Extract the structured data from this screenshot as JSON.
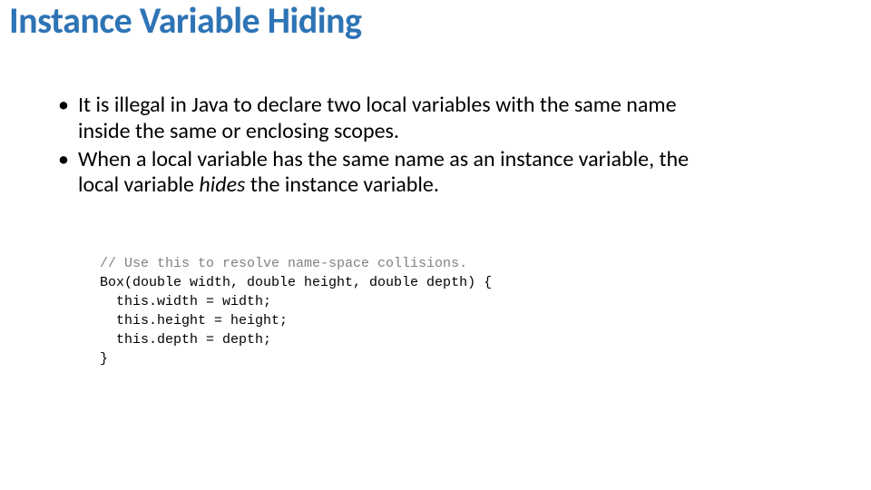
{
  "title": "Instance Variable Hiding",
  "bullets": {
    "b1a": "It is illegal in Java to declare two local variables with the same name",
    "b1b": "inside the same or enclosing scopes.",
    "b2a": "When a local variable has the same name as an instance variable, the",
    "b2b": "local variable ",
    "b2i": "hides",
    "b2c": " the instance variable."
  },
  "code": {
    "l1": "// Use this to resolve name-space collisions.",
    "l2": "Box(double width, double height, double depth) {",
    "l3": "  this.width = width;",
    "l4": "  this.height = height;",
    "l5": "  this.depth = depth;",
    "l6": "}"
  }
}
